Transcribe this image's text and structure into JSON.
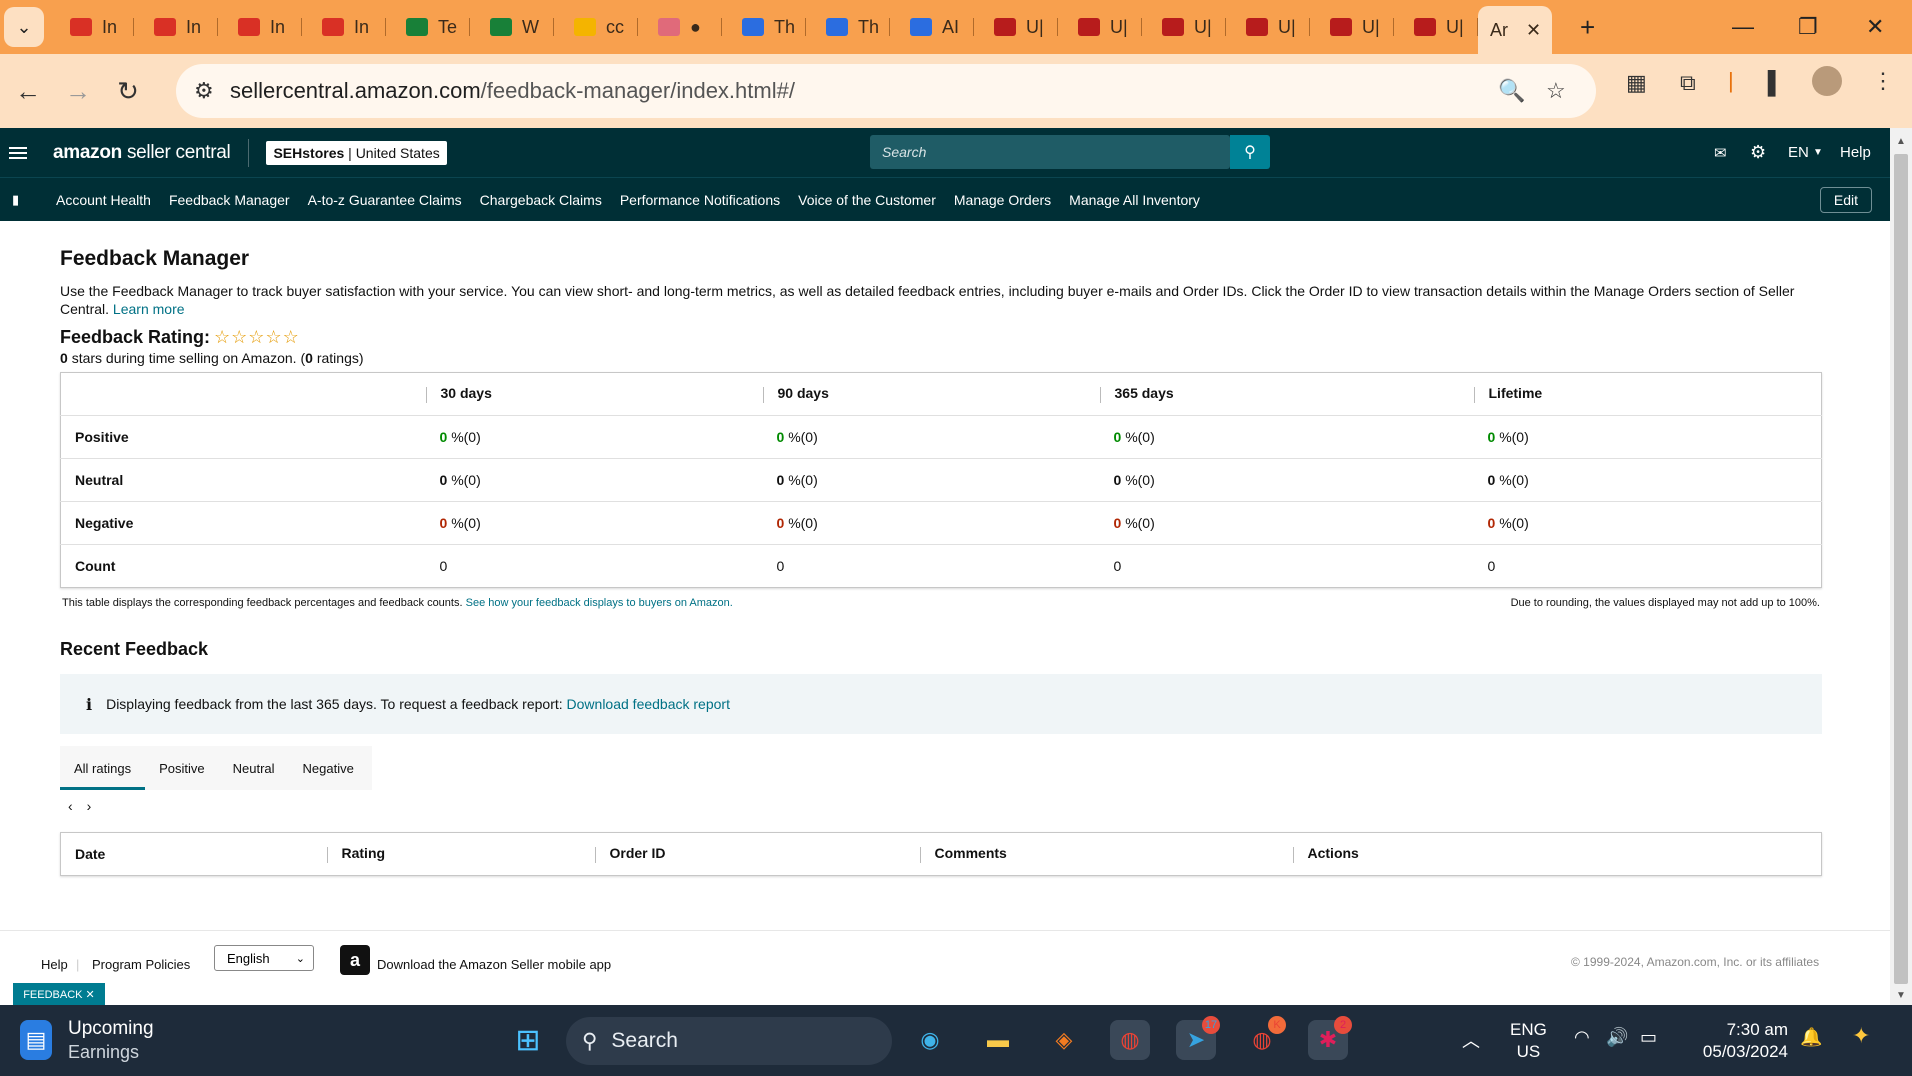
{
  "browser": {
    "tabs": [
      {
        "label": "In",
        "color": "#d93025"
      },
      {
        "label": "In",
        "color": "#d93025"
      },
      {
        "label": "In",
        "color": "#d93025"
      },
      {
        "label": "In",
        "color": "#d93025"
      },
      {
        "label": "Te",
        "color": "#188038"
      },
      {
        "label": "W",
        "color": "#188038"
      },
      {
        "label": "cc",
        "color": "#f4b400"
      },
      {
        "label": "●",
        "color": "#e06a7a"
      },
      {
        "label": "Th",
        "color": "#2b6de0"
      },
      {
        "label": "Th",
        "color": "#2b6de0"
      },
      {
        "label": "AI",
        "color": "#2b6de0"
      },
      {
        "label": "U|",
        "color": "#b71c1c"
      },
      {
        "label": "U|",
        "color": "#b71c1c"
      },
      {
        "label": "U|",
        "color": "#b71c1c"
      },
      {
        "label": "U|",
        "color": "#b71c1c"
      },
      {
        "label": "U|",
        "color": "#b71c1c"
      },
      {
        "label": "U|",
        "color": "#b71c1c"
      }
    ],
    "active_tab": "Ar",
    "url_host": "sellercentral.amazon.com",
    "url_path": "/feedback-manager/index.html#/"
  },
  "header": {
    "logo_bold": "amazon",
    "logo_light": "seller central",
    "store_name": "SEHstores",
    "store_region": "United States",
    "search_placeholder": "Search",
    "language": "EN",
    "help": "Help"
  },
  "nav": {
    "items": [
      "Account Health",
      "Feedback Manager",
      "A-to-z Guarantee Claims",
      "Chargeback Claims",
      "Performance Notifications",
      "Voice of the Customer",
      "Manage Orders",
      "Manage All Inventory"
    ],
    "edit": "Edit"
  },
  "page": {
    "title": "Feedback Manager",
    "description": "Use the Feedback Manager to track buyer satisfaction with your service. You can view short- and long-term metrics, as well as detailed feedback entries, including buyer e-mails and Order IDs. Click the Order ID to view transaction details within the Manage Orders section of Seller Central.",
    "learn_more": "Learn more",
    "rating_label": "Feedback Rating:",
    "stars": "☆☆☆☆☆",
    "stars_count": "0",
    "stars_text": "stars during time selling on Amazon. (",
    "ratings_count": "0",
    "ratings_text": "ratings)"
  },
  "feedback_table": {
    "columns": [
      "30 days",
      "90 days",
      "365 days",
      "Lifetime"
    ],
    "rows": [
      {
        "label": "Positive",
        "values": [
          "0",
          "0",
          "0",
          "0"
        ],
        "suffix": "%(0)",
        "tone": "positive"
      },
      {
        "label": "Neutral",
        "values": [
          "0",
          "0",
          "0",
          "0"
        ],
        "suffix": "%(0)",
        "tone": "neutral"
      },
      {
        "label": "Negative",
        "values": [
          "0",
          "0",
          "0",
          "0"
        ],
        "suffix": "%(0)",
        "tone": "negative"
      },
      {
        "label": "Count",
        "values": [
          "0",
          "0",
          "0",
          "0"
        ],
        "suffix": "",
        "tone": "count"
      }
    ],
    "note_left": "This table displays the corresponding feedback percentages and feedback counts.",
    "note_link": "See how your feedback displays to buyers on Amazon.",
    "note_right": "Due to rounding, the values displayed may not add up to 100%."
  },
  "recent": {
    "title": "Recent Feedback",
    "info_text": "Displaying feedback from the last 365 days. To request a feedback report:",
    "info_link": "Download feedback report",
    "tabs": [
      "All ratings",
      "Positive",
      "Neutral",
      "Negative"
    ],
    "active_tab": "All ratings",
    "columns": [
      "Date",
      "Rating",
      "Order ID",
      "Comments",
      "Actions"
    ]
  },
  "footer": {
    "help": "Help",
    "policies": "Program Policies",
    "language": "English",
    "app_text": "Download the Amazon Seller mobile app",
    "copyright": "© 1999-2024, Amazon.com, Inc. or its affiliates",
    "feedback_tab": "FEEDBACK ✕"
  },
  "taskbar": {
    "widget_title": "Upcoming",
    "widget_sub": "Earnings",
    "search": "Search",
    "lang1": "ENG",
    "lang2": "US",
    "time": "7:30 am",
    "date": "05/03/2024",
    "telegram_badge": "17",
    "chrome2_badge": "K",
    "slack_badge": "2"
  }
}
